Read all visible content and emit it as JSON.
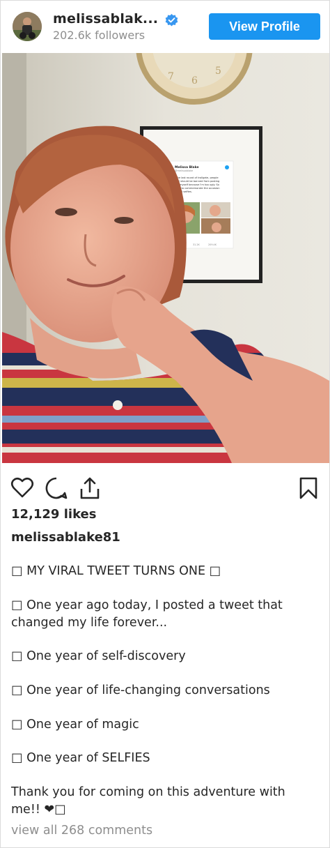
{
  "header": {
    "username": "melissablak...",
    "followers": "202.6k followers",
    "view_profile_label": "View Profile"
  },
  "photo": {
    "framed_tweet": {
      "name": "Melissa Blake",
      "handle": "@melissablake",
      "text_lines": [
        "During the last round of trollgate, people",
        "said that I should be banned from posting",
        "photos of myself because I'm too ugly. So",
        "I'd just like to commemorate the occasion",
        "with these 3 selfies."
      ],
      "date": "1 Aug 2018",
      "stats": [
        "8.6K",
        "31.2K",
        "209.4K"
      ]
    },
    "clock_numbers": [
      "7",
      "6",
      "5"
    ]
  },
  "actions": {
    "icons": [
      "heart-icon",
      "comment-icon",
      "share-icon",
      "bookmark-icon"
    ]
  },
  "post": {
    "likes": "12,129 likes",
    "author": "melissablake81",
    "caption": [
      "□ MY VIRAL TWEET TURNS ONE □",
      "□ One year ago today, I posted a tweet that",
      "changed my life forever...",
      "□ One year of self-discovery",
      "□ One year of life-changing conversations",
      "□ One year of magic",
      "□ One year of SELFIES",
      "Thank you for coming on this adventure with",
      "me!! ❤□"
    ],
    "comments_link": "view all 268 comments"
  },
  "colors": {
    "accent": "#1a95f0",
    "verified": "#3897f0",
    "muted": "#8e8e8e",
    "text": "#262626"
  }
}
